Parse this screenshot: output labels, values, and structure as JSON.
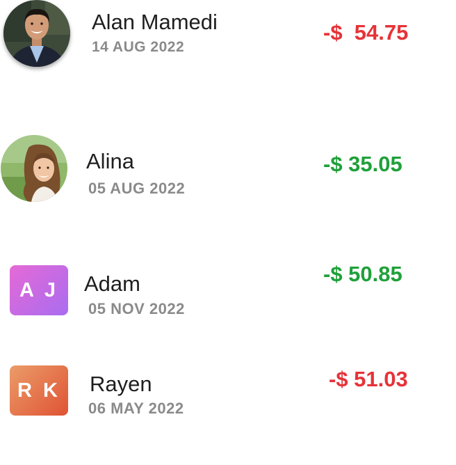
{
  "colors": {
    "negative": "#e63338",
    "positive": "#1fa03a",
    "name_text": "#1f1f1f",
    "date_text": "#8a8a8a",
    "aj_gradient": [
      "#e56ad6",
      "#a96cf0"
    ],
    "rk_gradient": [
      "#eb9c6a",
      "#df5333"
    ]
  },
  "transactions": [
    {
      "name": "Alan Mamedi",
      "date": "14 AUG 2022",
      "amount": "-$  54.75",
      "amount_color": "negative",
      "avatar": {
        "type": "photo",
        "icon": "man-portrait-photo"
      }
    },
    {
      "name": "Alina",
      "date": "05 AUG 2022",
      "amount": "-$ 35.05",
      "amount_color": "positive",
      "avatar": {
        "type": "photo",
        "icon": "girl-portrait-photo"
      }
    },
    {
      "name": "Adam",
      "date": "05 NOV 2022",
      "amount": "-$ 50.85",
      "amount_color": "positive",
      "avatar": {
        "type": "initials",
        "initials": "A J"
      }
    },
    {
      "name": "Rayen",
      "date": "06 MAY 2022",
      "amount": "-$ 51.03",
      "amount_color": "negative",
      "avatar": {
        "type": "initials",
        "initials": "R K"
      }
    }
  ]
}
